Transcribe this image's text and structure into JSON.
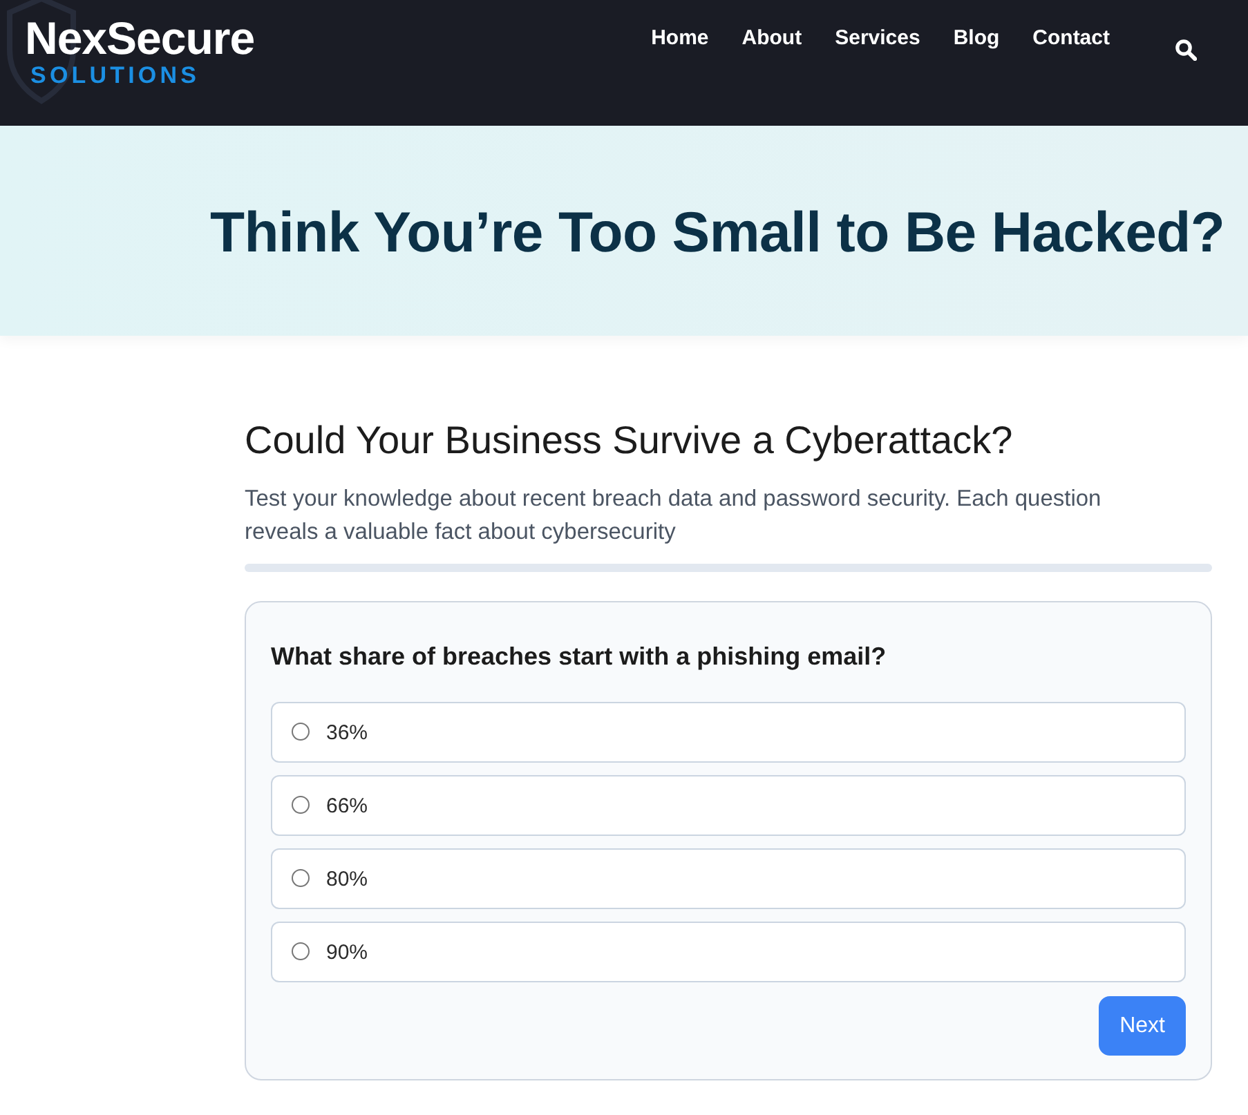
{
  "header": {
    "logo": {
      "name": "NexSecure",
      "tagline": "SOLUTIONS"
    },
    "nav": [
      "Home",
      "About",
      "Services",
      "Blog",
      "Contact"
    ]
  },
  "hero": {
    "title": "Think You’re Too Small to Be Hacked?"
  },
  "quiz": {
    "title": "Could Your Business Survive a Cyberattack?",
    "intro": "Test your knowledge about recent breach data and password security. Each question reveals a valuable fact about cybersecurity",
    "progress": {
      "level": 0
    },
    "question": "What share of breaches start with a phishing email?",
    "options": [
      {
        "label": "36%",
        "selected": false
      },
      {
        "label": "66%",
        "selected": false
      },
      {
        "label": "80%",
        "selected": false
      },
      {
        "label": "90%",
        "selected": false
      }
    ],
    "next_button": "Next"
  }
}
